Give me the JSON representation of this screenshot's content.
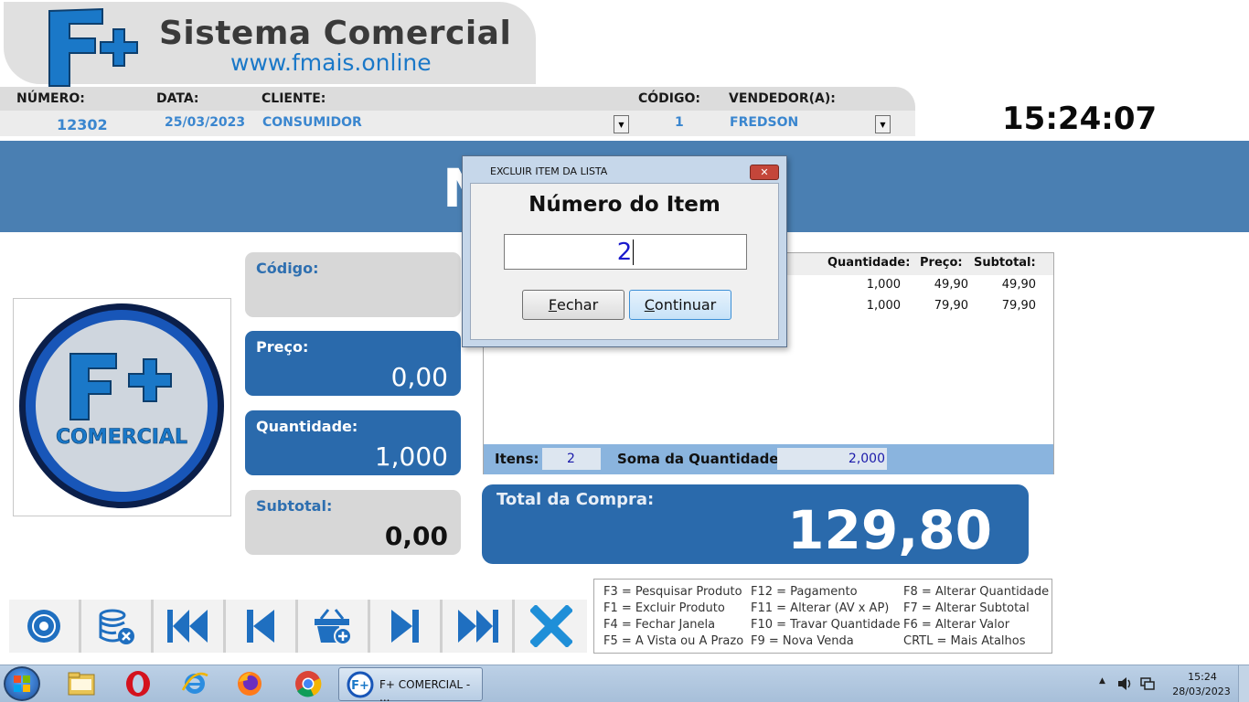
{
  "header": {
    "logo_mark": "F+",
    "title": "Sistema Comercial",
    "url": "www.fmais.online"
  },
  "info": {
    "numero_label": "NÚMERO:",
    "numero_value": "12302",
    "data_label": "DATA:",
    "data_value": "25/03/2023",
    "cliente_label": "CLIENTE:",
    "cliente_value": "CONSUMIDOR",
    "codigo_label": "CÓDIGO:",
    "codigo_value": "1",
    "vendedor_label": "VENDEDOR(A):",
    "vendedor_value": "FREDSON"
  },
  "clock": "15:24:07",
  "band_text": "N",
  "left_logo": {
    "mark": "F+",
    "text": "COMERCIAL"
  },
  "fields": {
    "codigo_label": "Código:",
    "codigo_value": "",
    "preco_label": "Preço:",
    "preco_value": "0,00",
    "quantidade_label": "Quantidade:",
    "quantidade_value": "1,000",
    "subtotal_label": "Subtotal:",
    "subtotal_value": "0,00"
  },
  "item_list": {
    "headers": {
      "quantidade": "Quantidade:",
      "preco": "Preço:",
      "subtotal": "Subtotal:"
    },
    "rows": [
      {
        "quantidade": "1,000",
        "preco": "49,90",
        "subtotal": "49,90"
      },
      {
        "quantidade": "1,000",
        "preco": "79,90",
        "subtotal": "79,90"
      }
    ],
    "itens_label": "Itens:",
    "itens_value": "2",
    "soma_label": "Soma da Quantidade:",
    "soma_value": "2,000"
  },
  "total": {
    "label": "Total da Compra:",
    "value": "129,80"
  },
  "toolbar": {
    "buttons": [
      "disc-icon",
      "database-remove-icon",
      "skip-first-icon",
      "skip-previous-icon",
      "basket-add-icon",
      "skip-next-icon",
      "skip-last-icon",
      "close-x-icon"
    ]
  },
  "shortcuts": [
    "F3 = Pesquisar Produto",
    "F12 = Pagamento",
    "F8 = Alterar Quantidade",
    "F1 = Excluir Produto",
    "F11 = Alterar (AV x AP)",
    "F7 = Alterar Subtotal",
    "F4 = Fechar Janela",
    "F10 = Travar Quantidade",
    "F6 = Alterar Valor",
    "F5 = A Vista ou A Prazo",
    "F9 = Nova Venda",
    "CRTL = Mais Atalhos"
  ],
  "dialog": {
    "title": "EXCLUIR ITEM DA LISTA",
    "close_glyph": "✕",
    "heading": "Número do Item",
    "input_value": "2",
    "close_first": "F",
    "close_rest": "echar",
    "continue_first": "C",
    "continue_rest": "ontinuar"
  },
  "taskbar": {
    "app_label": "F+ COMERCIAL - ...",
    "time": "15:24",
    "date": "28/03/2023"
  },
  "colors": {
    "accent_blue": "#2a6aac",
    "band_blue": "#4a7fb2",
    "link_blue": "#3a86cf"
  }
}
